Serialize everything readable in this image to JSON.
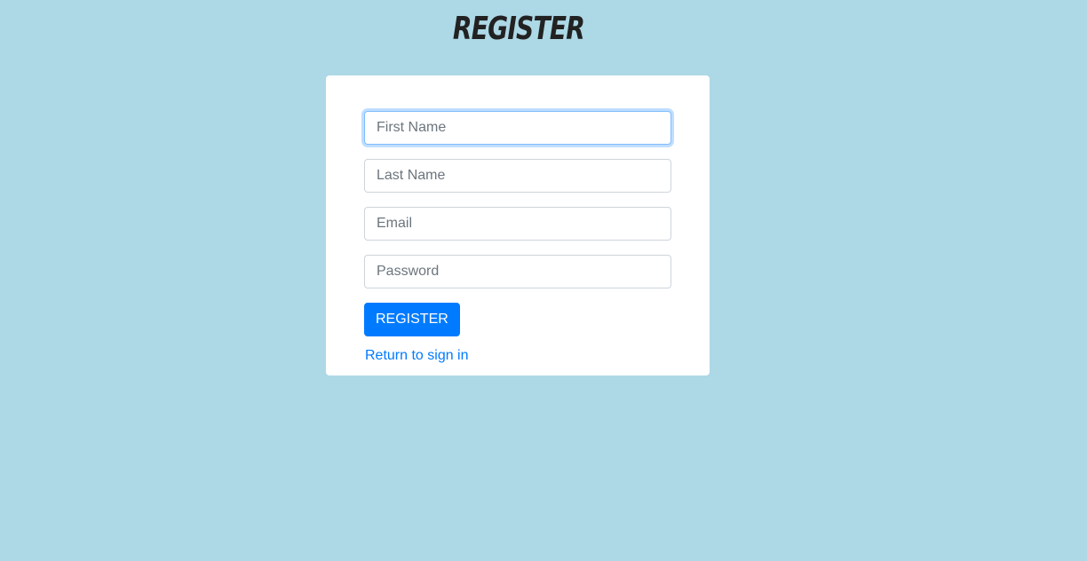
{
  "page": {
    "title": "REGISTER"
  },
  "form": {
    "first_name": {
      "placeholder": "First Name",
      "value": ""
    },
    "last_name": {
      "placeholder": "Last Name",
      "value": ""
    },
    "email": {
      "placeholder": "Email",
      "value": ""
    },
    "password": {
      "placeholder": "Password",
      "value": ""
    },
    "submit_label": "REGISTER",
    "signin_link": "Return to sign in"
  },
  "colors": {
    "background": "#add8e6",
    "primary": "#007bff",
    "card": "#ffffff"
  }
}
